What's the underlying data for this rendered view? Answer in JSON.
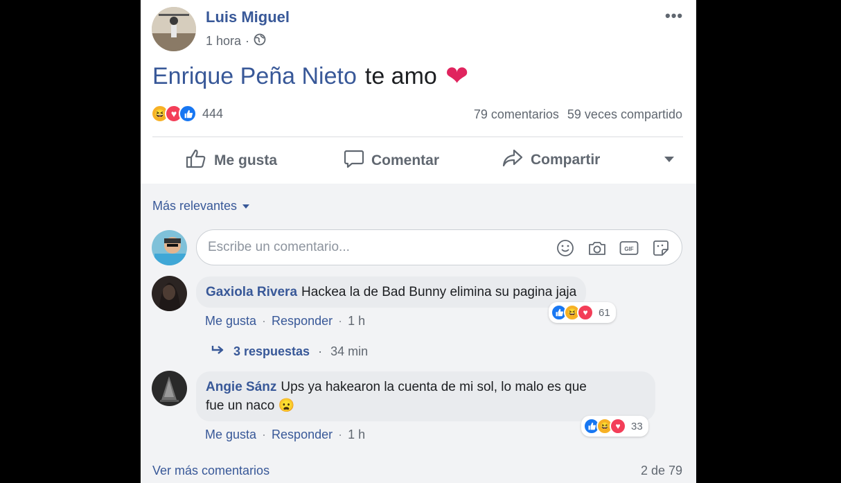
{
  "post": {
    "author": "Luis Miguel",
    "time": "1 hora",
    "time_separator": "·",
    "privacy_icon": "globe-icon",
    "more_label": "•••",
    "mention": "Enrique Peña Nieto",
    "message": "te amo",
    "emoji": "❤",
    "reaction_count": "444",
    "comments_count": "79 comentarios",
    "shares_count": "59 veces compartido",
    "reaction_icons": [
      "haha-icon",
      "love-icon",
      "like-icon"
    ]
  },
  "actions": {
    "like": "Me gusta",
    "comment": "Comentar",
    "share": "Compartir"
  },
  "sort_label": "Más relevantes",
  "comment_input": {
    "placeholder": "Escribe un comentario...",
    "icons": [
      "emoji-icon",
      "camera-icon",
      "gif-icon",
      "sticker-icon"
    ]
  },
  "comments": [
    {
      "author": "Gaxiola Rivera",
      "text": "Hackea la de Bad Bunny elimina su pagina jaja",
      "like_label": "Me gusta",
      "reply_label": "Responder",
      "time": "1 h",
      "reaction_count": "61",
      "replies_label": "3 respuestas",
      "replies_time": "34 min"
    },
    {
      "author": "Angie Sánz",
      "text_line1": "Ups ya hakearon la cuenta de mi sol, lo malo es que",
      "text_line2": "fue un naco",
      "emoji": "😦",
      "like_label": "Me gusta",
      "reply_label": "Responder",
      "time": "1 h",
      "reaction_count": "33"
    }
  ],
  "footer": {
    "more_comments": "Ver más comentarios",
    "count": "2 de 79"
  },
  "colors": {
    "link_blue": "#385898",
    "like_blue": "#1877f2",
    "love_red": "#f33e58",
    "haha_yellow": "#f7b125",
    "meta_gray": "#606770"
  }
}
